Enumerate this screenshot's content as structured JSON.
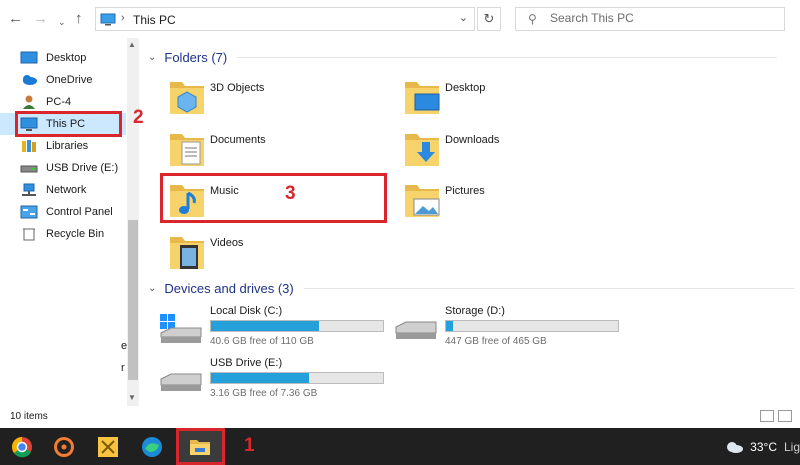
{
  "address": {
    "location": "This PC",
    "search_placeholder": "Search This PC"
  },
  "sidebar": {
    "items": [
      {
        "label": "Desktop",
        "icon": "desktop-icon"
      },
      {
        "label": "OneDrive",
        "icon": "onedrive-icon"
      },
      {
        "label": "PC-4",
        "icon": "user-icon"
      },
      {
        "label": "This PC",
        "icon": "this-pc-icon"
      },
      {
        "label": "Libraries",
        "icon": "libraries-icon"
      },
      {
        "label": "USB Drive (E:)",
        "icon": "usb-drive-icon"
      },
      {
        "label": "Network",
        "icon": "network-icon"
      },
      {
        "label": "Control Panel",
        "icon": "control-panel-icon"
      },
      {
        "label": "Recycle Bin",
        "icon": "recycle-bin-icon"
      }
    ],
    "partial_1": "e",
    "partial_2": "r"
  },
  "folders": {
    "header": "Folders (7)",
    "items": [
      {
        "label": "3D Objects"
      },
      {
        "label": "Desktop"
      },
      {
        "label": "Documents"
      },
      {
        "label": "Downloads"
      },
      {
        "label": "Music"
      },
      {
        "label": "Pictures"
      },
      {
        "label": "Videos"
      }
    ]
  },
  "drives": {
    "header": "Devices and drives (3)",
    "items": [
      {
        "name": "Local Disk (C:)",
        "free": "40.6 GB free of 110 GB",
        "used_fraction": 0.63
      },
      {
        "name": "Storage (D:)",
        "free": "447 GB free of 465 GB",
        "used_fraction": 0.04
      },
      {
        "name": "USB Drive (E:)",
        "free": "3.16 GB free of 7.36 GB",
        "used_fraction": 0.57
      }
    ]
  },
  "annotations": {
    "m1": "1",
    "m2": "2",
    "m3": "3"
  },
  "status": {
    "count": "10 items"
  },
  "tray": {
    "temp": "33°C",
    "weather": "Lig"
  },
  "colors": {
    "accent": "#26a0da",
    "highlight": "#d9262c",
    "selection": "#cce8ff",
    "taskbar": "#202020"
  }
}
